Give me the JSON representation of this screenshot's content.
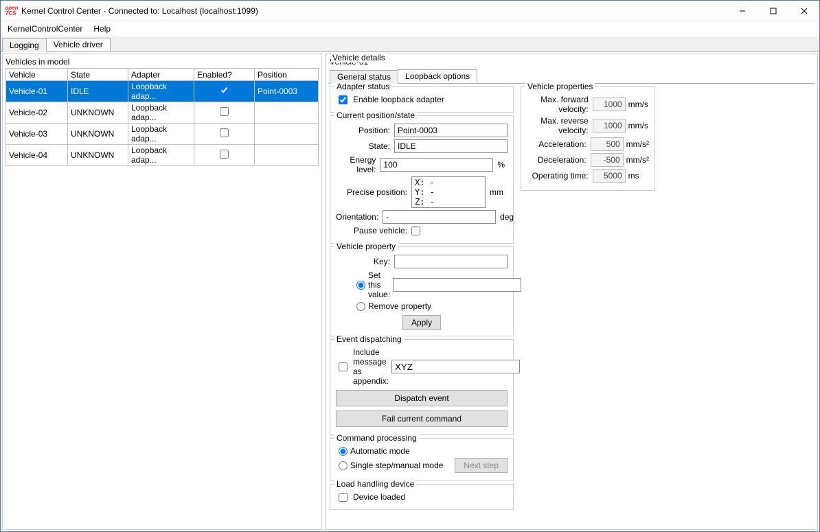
{
  "window": {
    "title": "Kernel Control Center - Connected to: Localhost (localhost:1099)"
  },
  "menu": {
    "items": [
      "KernelControlCenter",
      "Help"
    ]
  },
  "main_tabs": {
    "items": [
      "Logging",
      "Vehicle driver"
    ],
    "active": 1
  },
  "left": {
    "title": "Vehicles in model",
    "columns": [
      "Vehicle",
      "State",
      "Adapter",
      "Enabled?",
      "Position"
    ],
    "rows": [
      {
        "vehicle": "Vehicle-01",
        "state": "IDLE",
        "adapter": "Loopback adap...",
        "enabled": true,
        "position": "Point-0003",
        "selected": true
      },
      {
        "vehicle": "Vehicle-02",
        "state": "UNKNOWN",
        "adapter": "Loopback adap...",
        "enabled": false,
        "position": "",
        "selected": false
      },
      {
        "vehicle": "Vehicle-03",
        "state": "UNKNOWN",
        "adapter": "Loopback adap...",
        "enabled": false,
        "position": "",
        "selected": false
      },
      {
        "vehicle": "Vehicle-04",
        "state": "UNKNOWN",
        "adapter": "Loopback adap...",
        "enabled": false,
        "position": "",
        "selected": false
      }
    ]
  },
  "details": {
    "title": "Vehicle details",
    "vehicle_name": "Vehicle-01",
    "tabs": {
      "items": [
        "General status",
        "Loopback options"
      ],
      "active": 1
    },
    "adapter_status": {
      "legend": "Adapter status",
      "enable_label": "Enable loopback adapter",
      "enable_checked": true
    },
    "current_pos": {
      "legend": "Current position/state",
      "position_label": "Position:",
      "position_value": "Point-0003",
      "state_label": "State:",
      "state_value": "IDLE",
      "energy_label": "Energy level:",
      "energy_value": "100",
      "energy_unit": "%",
      "precise_label": "Precise position:",
      "precise_value": "X: -\nY: -\nZ: -",
      "precise_unit": "mm",
      "orientation_label": "Orientation:",
      "orientation_value": "-",
      "orientation_unit": "deg",
      "pause_label": "Pause vehicle:",
      "pause_checked": false
    },
    "vehicle_property": {
      "legend": "Vehicle property",
      "key_label": "Key:",
      "set_label": "Set this value:",
      "remove_label": "Remove property",
      "apply": "Apply"
    },
    "event": {
      "legend": "Event dispatching",
      "include_label": "Include message as appendix:",
      "include_checked": false,
      "appendix_value": "XYZ",
      "dispatch": "Dispatch event",
      "fail": "Fail current command"
    },
    "command": {
      "legend": "Command processing",
      "auto": "Automatic mode",
      "single": "Single step/manual mode",
      "next": "Next step"
    },
    "load": {
      "legend": "Load handling device",
      "loaded_label": "Device loaded",
      "loaded_checked": false
    }
  },
  "props": {
    "legend": "Vehicle properties",
    "rows": [
      {
        "label": "Max. forward velocity:",
        "value": "1000",
        "unit": "mm/s"
      },
      {
        "label": "Max. reverse velocity:",
        "value": "1000",
        "unit": "mm/s"
      },
      {
        "label": "Acceleration:",
        "value": "500",
        "unit": "mm/s²"
      },
      {
        "label": "Deceleration:",
        "value": "-500",
        "unit": "mm/s²"
      },
      {
        "label": "Operating time:",
        "value": "5000",
        "unit": "ms"
      }
    ]
  }
}
